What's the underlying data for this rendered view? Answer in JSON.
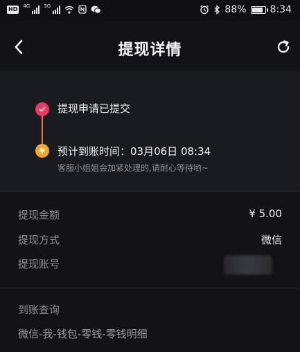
{
  "status_bar": {
    "hd_badge": "HD",
    "net1": "4G",
    "net2": "3G",
    "battery": "88%",
    "time": "8:34",
    "battery_level": 0.88
  },
  "header": {
    "title": "提现详情",
    "back_icon": "chevron-left-icon",
    "refresh_icon": "refresh-icon"
  },
  "timeline": {
    "step1_label": "提现申请已提交",
    "step2_label": "预计到账时间：03月06日 08:34",
    "step2_note": "客服小姐姐会加紧处理的,请耐心等待哟~",
    "step2_icon_glyph": "¥",
    "colors": {
      "done": "#f1365d",
      "pending": "#f5a623",
      "line": "#e87a32"
    }
  },
  "details": {
    "amount_label": "提现金额",
    "amount_value": "¥ 5.00",
    "method_label": "提现方式",
    "method_value": "微信",
    "account_label": "提现账号"
  },
  "query": {
    "title": "到账查询",
    "path": "微信-我-钱包-零钱-零钱明细"
  }
}
